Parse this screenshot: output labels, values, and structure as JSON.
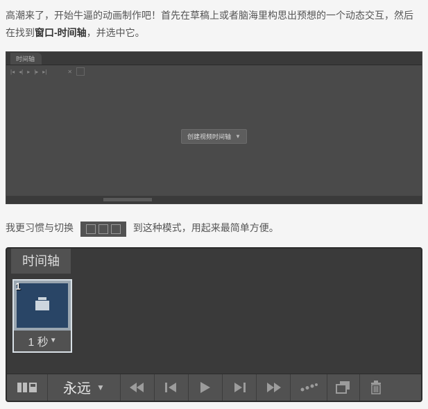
{
  "para1": {
    "pre": "高潮来了，开始牛逼的动画制作吧！首先在草稿上或者脑海里构思出预想的一个动态交互，然后在找到",
    "bold": "窗口-时间轴",
    "post": "，并选中它。"
  },
  "panel1": {
    "tab": "时间轴",
    "center_button": "创建视频时间轴"
  },
  "para2": {
    "pre": "我更习惯与切换",
    "post": "到这种模式，用起来最简单方便。"
  },
  "panel2": {
    "tab": "时间轴",
    "frame": {
      "num": "1",
      "time": "1 秒"
    },
    "loop_label": "永远"
  }
}
